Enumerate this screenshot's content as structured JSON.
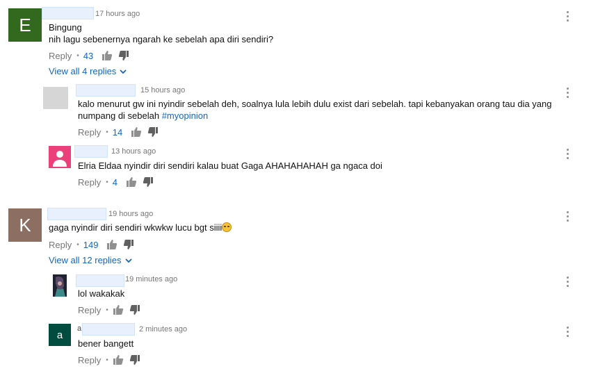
{
  "colors": {
    "link": "#1565c0",
    "meta": "#767676",
    "avatar_e": "#33691e",
    "avatar_k": "#8d6e63",
    "avatar_a": "#004d40",
    "avatar_pink": "#ec407a",
    "avatar_gray": "#d6d6d6"
  },
  "actions": {
    "reply_label": "Reply",
    "separator": "•"
  },
  "comments": [
    {
      "avatar_letter": "E",
      "time": "17 hours ago",
      "text_line1": "Bingung",
      "text_line2": "nih lagu sebenernya ngarah ke sebelah apa diri sendiri?",
      "likes": "43",
      "view_replies": "View all 4 replies",
      "replies": [
        {
          "time": "15 hours ago",
          "text_line1": "kalo menurut gw ini nyindir sebelah deh, soalnya lula lebih dulu exist dari sebelah. tapi kebanyakan orang tau dia yang",
          "text_line2": "numpang di sebelah ",
          "hashtag": "#myopinion",
          "likes": "14"
        },
        {
          "time": "13 hours ago",
          "text": "Elria Eldaa nyindir diri sendiri kalau buat Gaga AHAHAHAHAH ga ngaca doi",
          "likes": "4"
        }
      ]
    },
    {
      "avatar_letter": "K",
      "time": "19 hours ago",
      "text": "gaga nyindir diri sendiri wkwkw lucu bgt siiii",
      "likes": "149",
      "view_replies": "View all 12 replies",
      "replies": [
        {
          "time": "19 minutes ago",
          "text": "lol wakakak"
        },
        {
          "avatar_letter": "a",
          "name_initial": "a",
          "time": "2 minutes ago",
          "text": "bener bangett"
        }
      ]
    }
  ]
}
